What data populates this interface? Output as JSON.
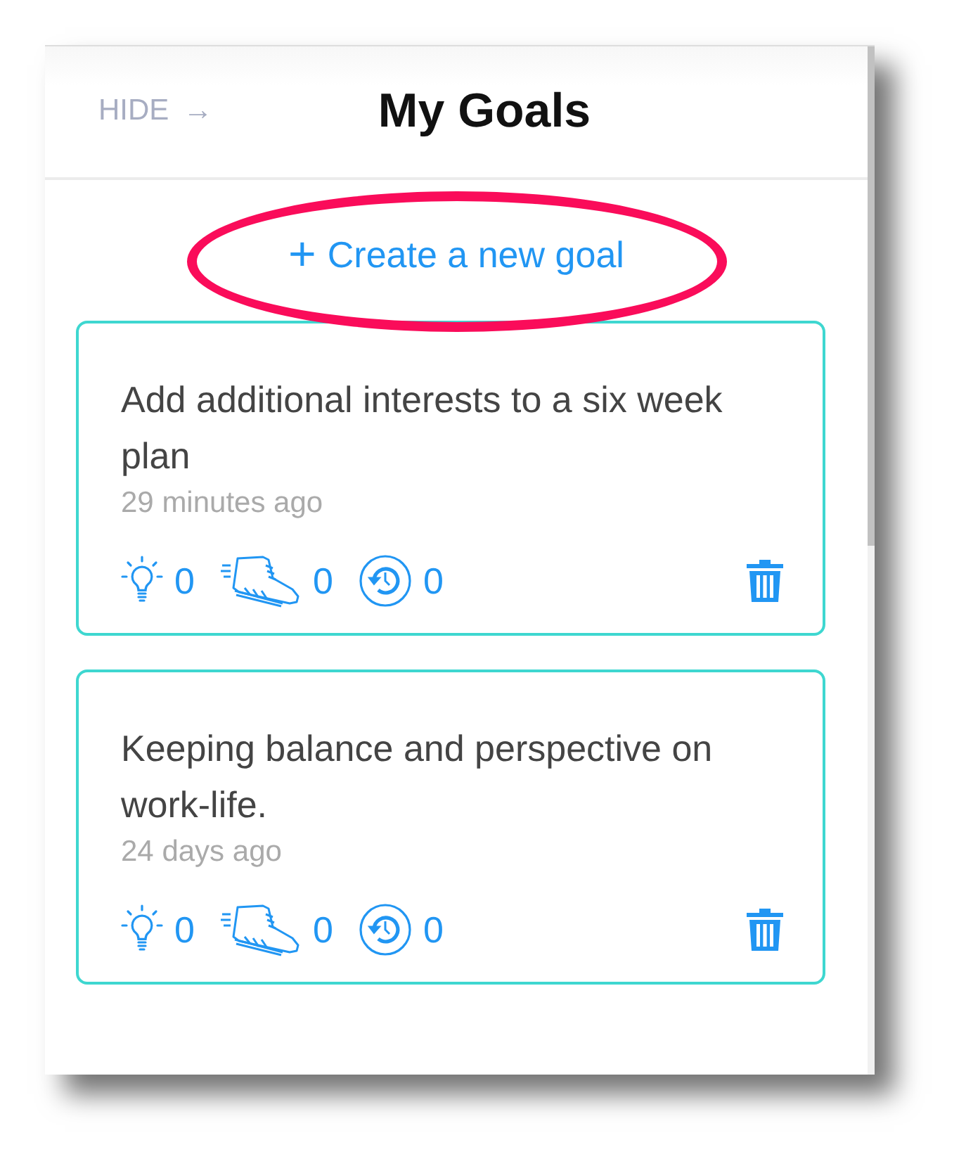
{
  "header": {
    "hide_label": "HIDE",
    "hide_arrow": "→",
    "title": "My Goals"
  },
  "create_button": {
    "icon": "+",
    "label": "Create a new goal",
    "circled": true
  },
  "goals": [
    {
      "title": "Add additional interests to a six week plan",
      "time": "29 minutes ago",
      "ideas": "0",
      "steps": "0",
      "reviews": "0"
    },
    {
      "title": "Keeping balance and perspective on work-life.",
      "time": "24 days ago",
      "ideas": "0",
      "steps": "0",
      "reviews": "0"
    }
  ]
}
